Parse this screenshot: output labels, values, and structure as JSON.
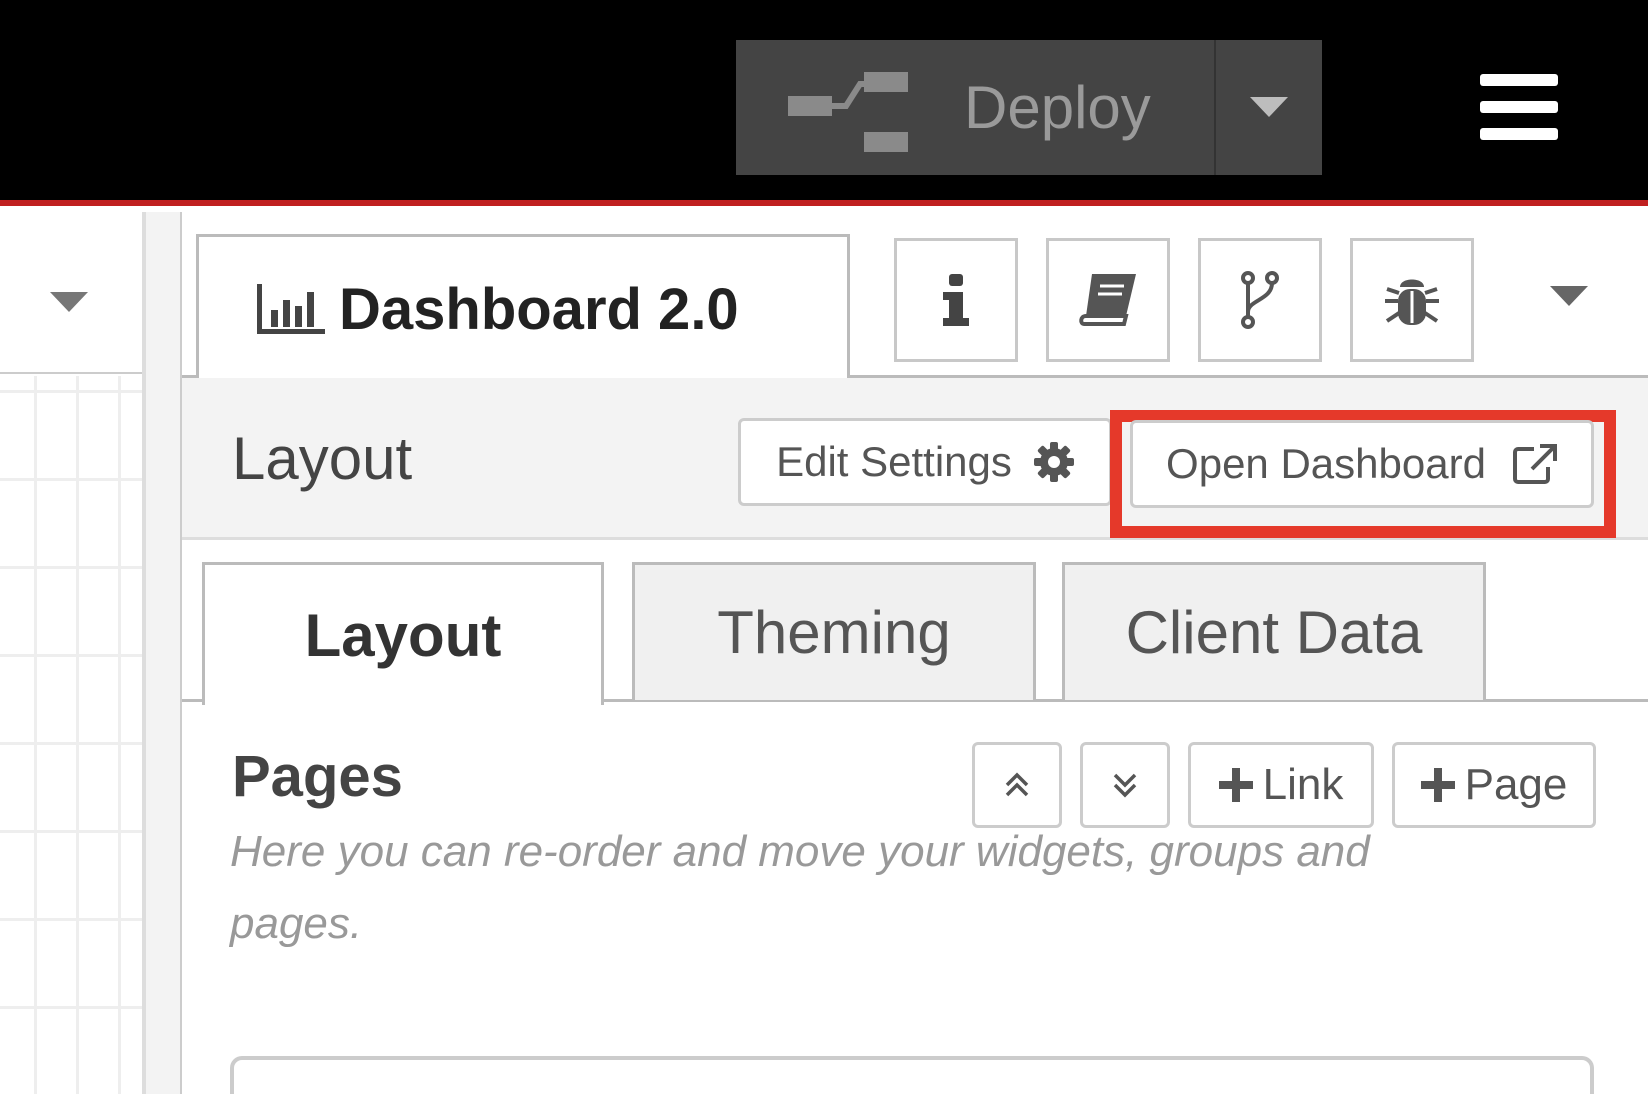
{
  "header": {
    "deploy_label": "Deploy",
    "deploy_icon": "deploy-flow-icon",
    "deploy_menu_icon": "caret-down-icon",
    "menu_icon": "hamburger-menu-icon"
  },
  "workspace": {
    "menu_icon": "caret-down-icon"
  },
  "sidebar": {
    "active_tab": {
      "icon": "bar-chart-icon",
      "label": "Dashboard 2.0"
    },
    "icon_tabs": [
      {
        "icon": "info-icon"
      },
      {
        "icon": "book-icon"
      },
      {
        "icon": "git-branch-icon"
      },
      {
        "icon": "bug-icon"
      }
    ],
    "more_icon": "caret-down-icon"
  },
  "panel": {
    "title": "Layout",
    "edit_settings_label": "Edit Settings",
    "open_dashboard_label": "Open Dashboard",
    "highlight_color": "#e5392a"
  },
  "subtabs": [
    {
      "label": "Layout",
      "active": true
    },
    {
      "label": "Theming",
      "active": false
    },
    {
      "label": "Client Data",
      "active": false
    }
  ],
  "pages": {
    "title": "Pages",
    "link_label": "Link",
    "page_label": "Page",
    "help_text": "Here you can re-order and move your widgets, groups and pages."
  },
  "colors": {
    "header_bg": "#000000",
    "header_accent": "#c02020",
    "deploy_bg": "#444444"
  }
}
